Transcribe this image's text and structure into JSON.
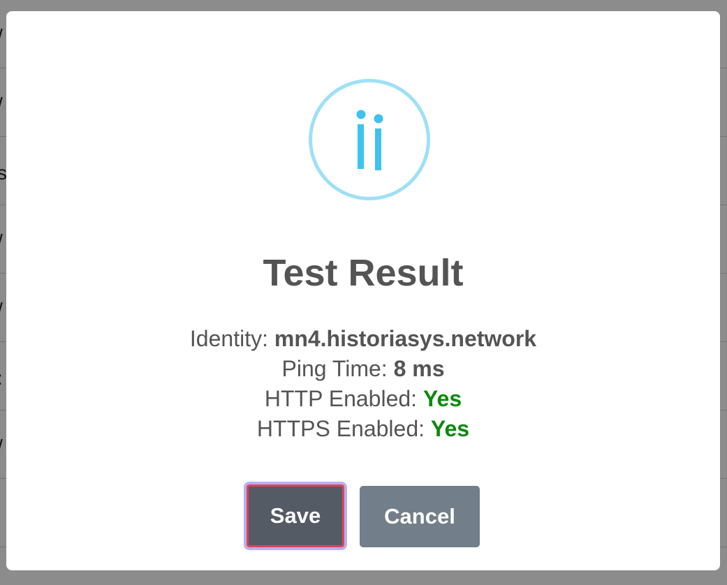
{
  "dialog": {
    "icon": "info-icon",
    "title": "Test Result",
    "details": [
      {
        "label": "Identity: ",
        "value": "mn4.historiasys.network",
        "status": "plain"
      },
      {
        "label": "Ping Time: ",
        "value": "8 ms",
        "status": "plain"
      },
      {
        "label": "HTTP Enabled: ",
        "value": "Yes",
        "status": "yes"
      },
      {
        "label": "HTTPS Enabled: ",
        "value": "Yes",
        "status": "yes"
      }
    ],
    "save_label": "Save",
    "cancel_label": "Cancel"
  },
  "colors": {
    "icon_ring": "#9ee0f6",
    "icon_glyph": "#3fc3ee",
    "title": "#545454",
    "success": "#0a8a0a",
    "save_bg": "#545b64",
    "save_focus_border": "#e0435a",
    "cancel_bg": "#727f8a"
  }
}
